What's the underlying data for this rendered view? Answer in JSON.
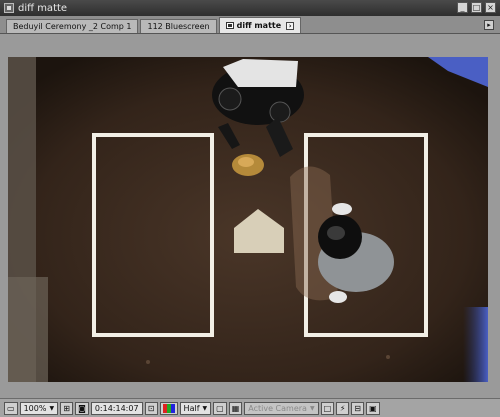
{
  "window": {
    "title": "diff matte"
  },
  "tabs": [
    {
      "label": "Beduyil Ceremony _2 Comp 1"
    },
    {
      "label": "112 Bluescreen"
    },
    {
      "label": "diff matte"
    }
  ],
  "toolbar": {
    "zoom": "100%",
    "timecode": "0:14:14:07",
    "resolution": "Half",
    "camera": "Active Camera"
  },
  "colors": {
    "dirt": "#3a2a20",
    "chalk": "#f2efe6",
    "plate": "#d8cfb8",
    "sky_blue": "#4a5fc4"
  },
  "icons": [
    "app-icon",
    "minimize-icon",
    "maximize-icon",
    "close-icon",
    "comp-icon",
    "tab-close-icon",
    "panel-menu-icon",
    "snapshot-icon",
    "show-snapshot-icon",
    "channel-icon",
    "region-icon",
    "transparency-grid-icon",
    "fast-preview-icon",
    "flowchart-icon"
  ]
}
